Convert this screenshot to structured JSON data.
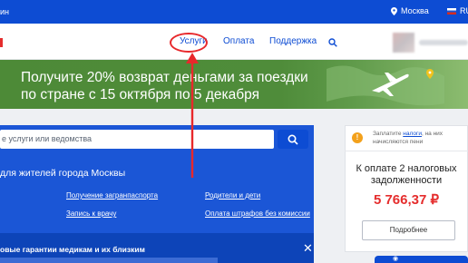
{
  "topbar": {
    "left_fragment": "ин",
    "location": "Москва",
    "language": "RU"
  },
  "nav": {
    "services": "Услуги",
    "payment": "Оплата",
    "support": "Поддержка"
  },
  "banner": {
    "line1": "Получите 20% возврат деньгами за поездки",
    "line2": "по стране с 15 октября по 5 декабря"
  },
  "search": {
    "placeholder": "е услуги или ведомства"
  },
  "residents_title": "для жителей города Москвы",
  "links": [
    "Получение загранпаспорта",
    "Родители и дети",
    "Запись к врачу",
    "Оплата штрафов без комиссии"
  ],
  "news": {
    "title": "овые гарантии медикам и их близким"
  },
  "payment_card": {
    "note_prefix": "Заплатите",
    "note_link": "налоги",
    "note_suffix": ", на них",
    "note_line2": "начисляются пени",
    "due_title": "К оплате 2 налоговых задолженности",
    "amount": "5 766,37 ₽",
    "details_button": "Подробнее"
  },
  "colors": {
    "primary": "#0d4cd3",
    "accent_red": "#e52d2d",
    "banner_green": "#4d8a37",
    "warning": "#f3a11c"
  }
}
